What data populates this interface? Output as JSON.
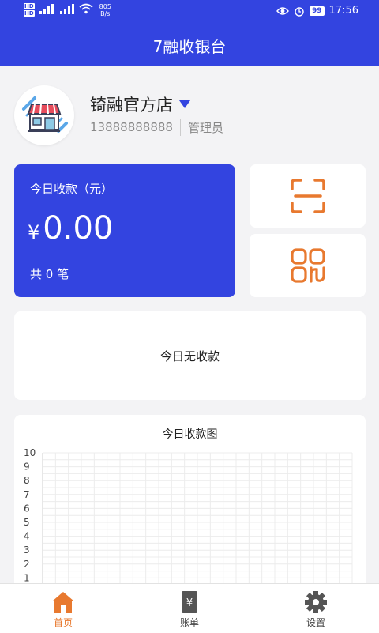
{
  "status_bar": {
    "hd_top": "HD",
    "hd_bottom": "HD",
    "net_speed_value": "805",
    "net_speed_unit": "B/s",
    "battery": "99",
    "time": "17:56"
  },
  "header": {
    "title": "7融收银台"
  },
  "store": {
    "name": "锜融官方店",
    "phone": "13888888888",
    "role": "管理员"
  },
  "income": {
    "label": "今日收款（元）",
    "currency": "¥",
    "amount": "0.00",
    "count_text": "共 0 笔"
  },
  "tiles": {
    "scan_icon": "scan-icon",
    "qrcode_icon": "qrcode-icon"
  },
  "empty_state": {
    "text": "今日无收款"
  },
  "colors": {
    "primary": "#3344e0",
    "accent": "#e8792f"
  },
  "chart_data": {
    "type": "line",
    "title": "今日收款图",
    "xlabel": "",
    "ylabel": "",
    "ylim": [
      0,
      10
    ],
    "y_ticks": [
      "1",
      "2",
      "3",
      "4",
      "5",
      "6",
      "7",
      "8",
      "9",
      "10"
    ],
    "grid": true,
    "series": []
  },
  "tabbar": {
    "items": [
      {
        "label": "首页",
        "icon": "home-icon",
        "active": true
      },
      {
        "label": "账单",
        "icon": "bill-icon",
        "active": false
      },
      {
        "label": "设置",
        "icon": "gear-icon",
        "active": false
      }
    ]
  }
}
